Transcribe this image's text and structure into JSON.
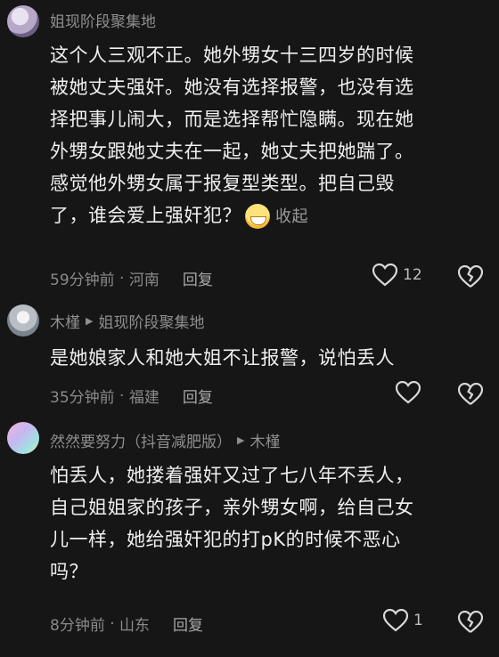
{
  "comments": [
    {
      "author": "姐现阶段聚集地",
      "reply_to": "",
      "lines": [
        "这个人三观不正。她外甥女十三四岁的时候",
        "被她丈夫强奸。她没有选择报警，也没有选",
        "择把事儿闹大，而是选择帮忙隐瞒。现在她",
        "外甥女跟她丈夫在一起，她丈夫把她踹了。",
        "感觉他外甥女属于报复型类型。把自己毁",
        "了，谁会爱上强奸犯？"
      ],
      "collapse_label": "收起",
      "time": "59分钟前",
      "location": "河南",
      "reply_label": "回复",
      "like_count": "12"
    },
    {
      "author": "木槿",
      "reply_to": "姐现阶段聚集地",
      "lines": [
        "是她娘家人和她大姐不让报警，说怕丢人"
      ],
      "time": "35分钟前",
      "location": "福建",
      "reply_label": "回复",
      "like_count": ""
    },
    {
      "author": "然然要努力（抖音减肥版）",
      "reply_to": "木槿",
      "lines": [
        "怕丢人，她搂着强奸又过了七八年不丢人，",
        "自己姐姐家的孩子，亲外甥女啊，给自己女",
        "儿一样，她给强奸犯的打pK的时候不恶心",
        "吗？"
      ],
      "time": "8分钟前",
      "location": "山东",
      "reply_label": "回复",
      "like_count": "1"
    }
  ],
  "icons": {
    "like": "heart-outline-icon",
    "dislike": "broken-heart-icon",
    "reply_arrow": "triangle-right-icon",
    "emoji": "grinning-sweat-emoji"
  },
  "colors": {
    "background": "#161616",
    "text": "#efefef",
    "muted": "#8a8a8a"
  }
}
